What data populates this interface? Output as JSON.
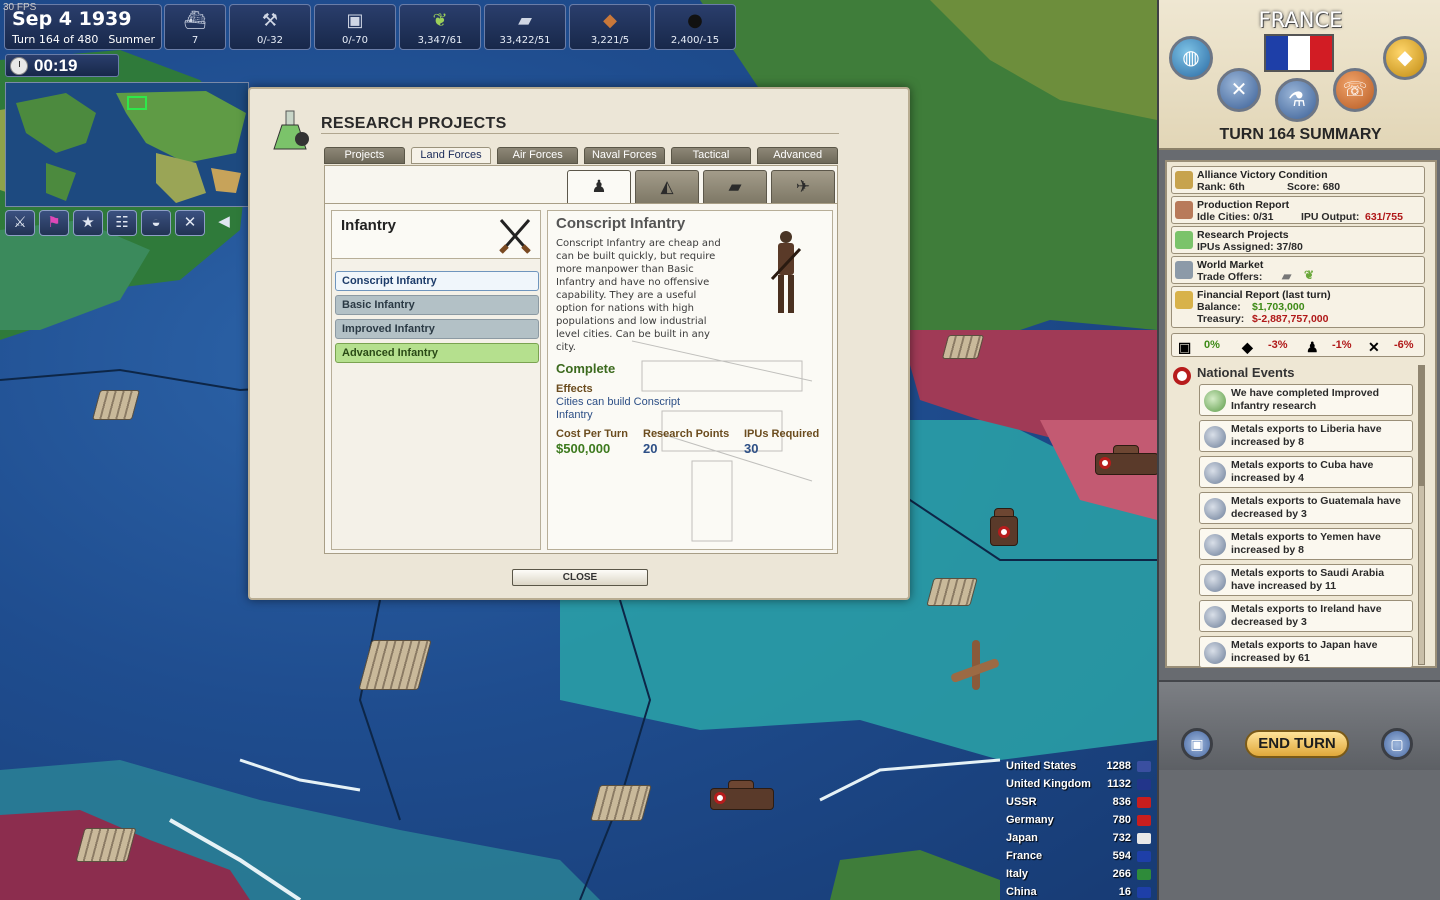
{
  "hud": {
    "fps": "30 FPS",
    "date": "Sep 4 1939",
    "turn_line": "Turn 164 of 480",
    "season": "Summer",
    "timer": "00:19",
    "resources": [
      {
        "icon": "ship-icon",
        "value": "7"
      },
      {
        "icon": "transport-icon",
        "value": "0/-32"
      },
      {
        "icon": "factory-icon",
        "value": "0/-70"
      },
      {
        "icon": "food-icon",
        "value": "3,347/61"
      },
      {
        "icon": "steel-icon",
        "value": "33,422/51"
      },
      {
        "icon": "ore-icon",
        "value": "3,221/5"
      },
      {
        "icon": "oil-icon",
        "value": "2,400/-15"
      }
    ]
  },
  "research": {
    "title": "RESEARCH PROJECTS",
    "tabs": [
      "Projects",
      "Land Forces",
      "Air Forces",
      "Naval Forces",
      "Tactical",
      "Advanced"
    ],
    "active_tab": "Land Forces",
    "category": "Infantry",
    "projects": [
      "Conscript Infantry",
      "Basic Infantry",
      "Improved Infantry",
      "Advanced Infantry"
    ],
    "detail": {
      "title": "Conscript Infantry",
      "description": "Conscript Infantry are cheap and can be built quickly, but require more manpower than Basic Infantry and have no offensive capability.  They are a useful option for nations with high populations and low industrial level cities.  Can be built in any city.",
      "status": "Complete",
      "effects_heading": "Effects",
      "effects": "Cities can build Conscript Infantry",
      "cost_label": "Cost Per Turn",
      "cost_value": "$500,000",
      "rp_label": "Research Points",
      "rp_value": "20",
      "ipu_label": "IPUs Required",
      "ipu_value": "30"
    },
    "close_label": "CLOSE"
  },
  "side": {
    "nation": "FRANCE",
    "flag_colors": [
      "#1e3fa8",
      "#ffffff",
      "#d21c24"
    ],
    "summary_title": "TURN 164 SUMMARY",
    "alliance": {
      "title": "Alliance Victory Condition",
      "rank": "Rank: 6th",
      "score": "Score: 680"
    },
    "production": {
      "title": "Production Report",
      "idle": "Idle Cities: 0/31",
      "ipu_label": "IPU Output: ",
      "ipu_value": "631/755"
    },
    "research": {
      "title": "Research Projects",
      "ipus": "IPUs Assigned: 37/80"
    },
    "market": {
      "title": "World Market",
      "offers": "Trade Offers:"
    },
    "finance": {
      "title": "Financial Report (last turn)",
      "balance_label": "Balance:",
      "balance_value": "$1,703,000",
      "treasury_label": "Treasury:",
      "treasury_value": "$-2,887,757,000"
    },
    "percents": [
      "0%",
      "-3%",
      "-1%",
      "-6%"
    ],
    "events_title": "National Events",
    "events": [
      "We have completed Improved Infantry research",
      "Metals exports to Liberia have increased by 8",
      "Metals exports to Cuba have increased by 4",
      "Metals exports to Guatemala have decreased by 3",
      "Metals exports to Yemen have increased by 8",
      "Metals exports to Saudi Arabia have increased by 11",
      "Metals exports to Ireland have decreased by 3",
      "Metals exports to Japan have increased by 61"
    ],
    "end_turn": "END TURN"
  },
  "rankings": [
    {
      "name": "United States",
      "value": "1288",
      "flag": "#3a4fa0"
    },
    {
      "name": "United Kingdom",
      "value": "1132",
      "flag": "#22358a"
    },
    {
      "name": "USSR",
      "value": "836",
      "flag": "#c81e1e"
    },
    {
      "name": "Germany",
      "value": "780",
      "flag": "#c81e1e"
    },
    {
      "name": "Japan",
      "value": "732",
      "flag": "#e8e8e8"
    },
    {
      "name": "France",
      "value": "594",
      "flag": "#1e3fa8"
    },
    {
      "name": "Italy",
      "value": "266",
      "flag": "#2e8b3a"
    },
    {
      "name": "China",
      "value": "16",
      "flag": "#1e3fa8"
    }
  ]
}
